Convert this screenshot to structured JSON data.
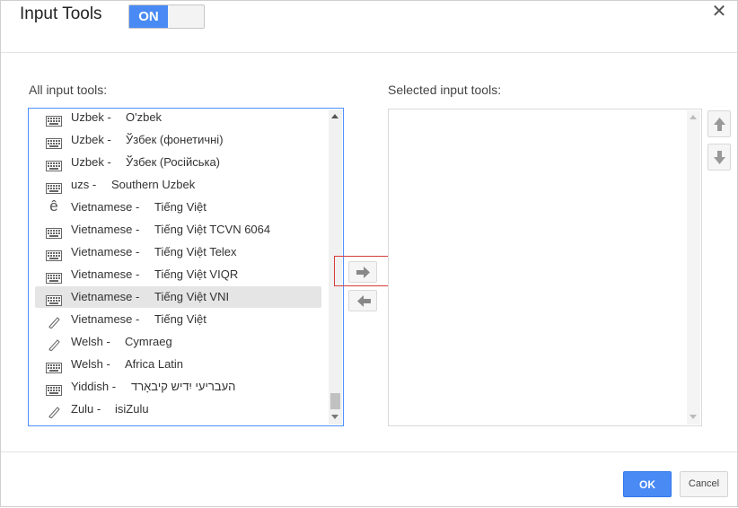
{
  "header": {
    "title": "Input Tools",
    "toggle_on_label": "ON",
    "close_glyph": "✕"
  },
  "labels": {
    "all_tools": "All input tools:",
    "selected_tools": "Selected input tools:"
  },
  "tools": [
    {
      "lang": "Uzbek -",
      "name": "O'zbek",
      "icon": "keyboard-icon"
    },
    {
      "lang": "Uzbek -",
      "name": "Ўзбек (фонетичні)",
      "icon": "keyboard-icon"
    },
    {
      "lang": "Uzbek -",
      "name": "Ўзбек (Російська)",
      "icon": "keyboard-icon"
    },
    {
      "lang": "uzs -",
      "name": "Southern Uzbek",
      "icon": "keyboard-icon"
    },
    {
      "lang": "Vietnamese -",
      "name": "Tiếng Việt",
      "icon": "transliteration-icon",
      "glyph": "ê"
    },
    {
      "lang": "Vietnamese -",
      "name": "Tiếng Việt TCVN 6064",
      "icon": "keyboard-icon"
    },
    {
      "lang": "Vietnamese -",
      "name": "Tiếng Việt Telex",
      "icon": "keyboard-icon"
    },
    {
      "lang": "Vietnamese -",
      "name": "Tiếng Việt VIQR",
      "icon": "keyboard-icon"
    },
    {
      "lang": "Vietnamese -",
      "name": "Tiếng Việt VNI",
      "icon": "keyboard-icon",
      "selected": true
    },
    {
      "lang": "Vietnamese -",
      "name": "Tiếng Việt",
      "icon": "handwriting-icon"
    },
    {
      "lang": "Welsh -",
      "name": "Cymraeg",
      "icon": "handwriting-icon"
    },
    {
      "lang": "Welsh -",
      "name": "Africa Latin",
      "icon": "keyboard-icon"
    },
    {
      "lang": "Yiddish -",
      "name": "העבריעי יִדיש קיבאָרד",
      "icon": "keyboard-icon"
    },
    {
      "lang": "Zulu -",
      "name": "isiZulu",
      "icon": "handwriting-icon"
    }
  ],
  "footer": {
    "ok_label": "OK",
    "cancel_label": "Cancel"
  },
  "colors": {
    "accent": "#4a8af4",
    "highlight": "#d63b3b",
    "selected_row": "#e5e5e5"
  }
}
